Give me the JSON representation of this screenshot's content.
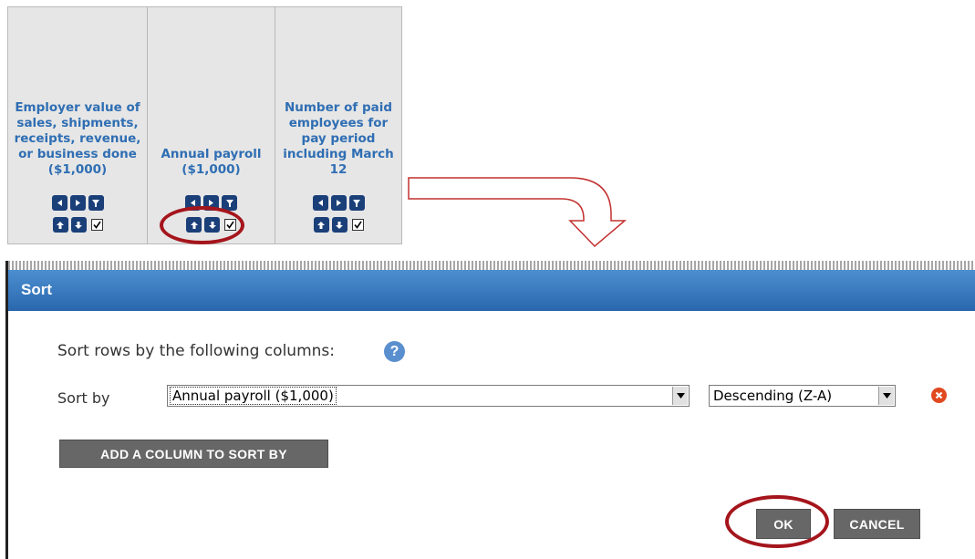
{
  "columns": [
    {
      "title": "Employer value of sales, shipments, receipts, revenue, or business done ($1,000)",
      "checked": true
    },
    {
      "title": "Annual payroll ($1,000)",
      "checked": true
    },
    {
      "title": "Number of paid employees for pay period including March 12",
      "checked": true
    }
  ],
  "dialog": {
    "title": "Sort",
    "intro": "Sort rows by the following columns:",
    "help_icon": "?",
    "sort_by_label": "Sort by",
    "column_select_value": "Annual payroll ($1,000)",
    "order_select_value": "Descending (Z-A)",
    "add_column_label": "ADD A COLUMN TO SORT BY",
    "ok_label": "OK",
    "cancel_label": "CANCEL"
  },
  "colors": {
    "header_blue": "#2f6eb3",
    "icon_navy": "#1a3f79",
    "dialog_header": "#3a7bc0",
    "button_gray": "#676767",
    "highlight_red": "#a5151c",
    "remove_orange": "#e0481e"
  },
  "icons": [
    "left-arrow-icon",
    "right-arrow-icon",
    "filter-icon",
    "sort-ascending-icon",
    "sort-descending-icon",
    "checkbox",
    "help-icon",
    "remove-icon",
    "dropdown-arrow-icon"
  ]
}
